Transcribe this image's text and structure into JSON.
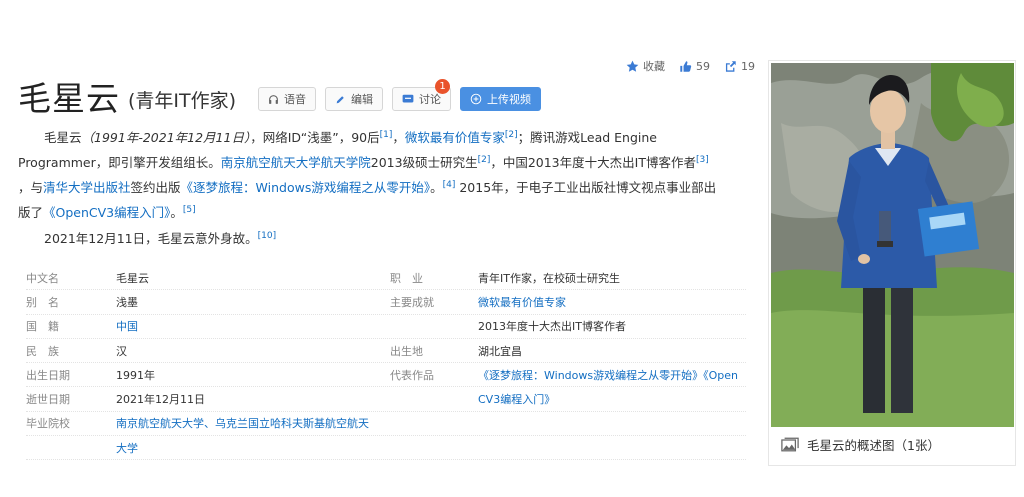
{
  "actions": {
    "collect": "收藏",
    "like_count": "59",
    "share_count": "19"
  },
  "title": {
    "name": "毛星云",
    "subtitle": "(青年IT作家)"
  },
  "toolbar": {
    "voice": "语音",
    "edit": "编辑",
    "discuss": "讨论",
    "discuss_badge": "1",
    "upload": "上传视频"
  },
  "summary": {
    "p1_name": "毛星云",
    "p1_dates": "（1991年-2021年12月11日）",
    "p1_a": "，网络ID“浅墨”，90后",
    "ref1": "[1]",
    "p1_b": "，",
    "link_mvp": "微软最有价值专家",
    "ref2": "[2]",
    "p1_c": "；腾讯游戏Lead Engine",
    "line2_a": "Programmer，即引擎开发组组长。",
    "link_school": "南京航空航天大学航天学院",
    "line2_b": "2013级硕士研究生",
    "ref2b": "[2]",
    "line2_c": "，中国2013年度十大杰出IT博客作者",
    "ref3": "[3]",
    "line3_a": "，与",
    "link_press": "清华大学出版社",
    "line3_b": "签约出版",
    "link_book": "《逐梦旅程：Windows游戏编程之从零开始》",
    "line3_c": "。",
    "ref4": "[4]",
    "line3_d": " 2015年，于电子工业出版社博文视点事业部出",
    "line4_a": "版了",
    "link_opencv": "《OpenCV3编程入门》",
    "line4_b": "。",
    "ref5": "[5]",
    "death": "2021年12月11日，毛星云意外身故。",
    "ref10": "[10]"
  },
  "info": {
    "rows": [
      {
        "k1": "中文名",
        "v1": "毛星云",
        "k2": "职　业",
        "v2": "青年IT作家，在校硕士研究生"
      },
      {
        "k1": "别　名",
        "v1": "浅墨",
        "k2": "主要成就",
        "v2": "微软最有价值专家"
      },
      {
        "k1": "国　籍",
        "v1": "中国",
        "k2": "",
        "v2": "2013年度十大杰出IT博客作者"
      },
      {
        "k1": "民　族",
        "v1": "汉",
        "k2": "出生地",
        "v2": "湖北宜昌"
      },
      {
        "k1": "出生日期",
        "v1": "1991年",
        "k2": "代表作品",
        "v2": "《逐梦旅程：Windows游戏编程之从零开始》《Open"
      },
      {
        "k1": "逝世日期",
        "v1": "2021年12月11日",
        "k2": "",
        "v2": "CV3编程入门》"
      },
      {
        "k1": "毕业院校",
        "v1": "南京航空航天大学、乌克兰国立哈科夫斯基航空航天",
        "k2": "",
        "v2": ""
      },
      {
        "k1": "",
        "v1": "大学",
        "k2": "",
        "v2": ""
      }
    ]
  },
  "photo": {
    "caption": "毛星云的概述图（1张）"
  },
  "colors": {
    "link": "#136ec2",
    "button_blue": "#4a90e2",
    "badge": "#e9532b"
  }
}
